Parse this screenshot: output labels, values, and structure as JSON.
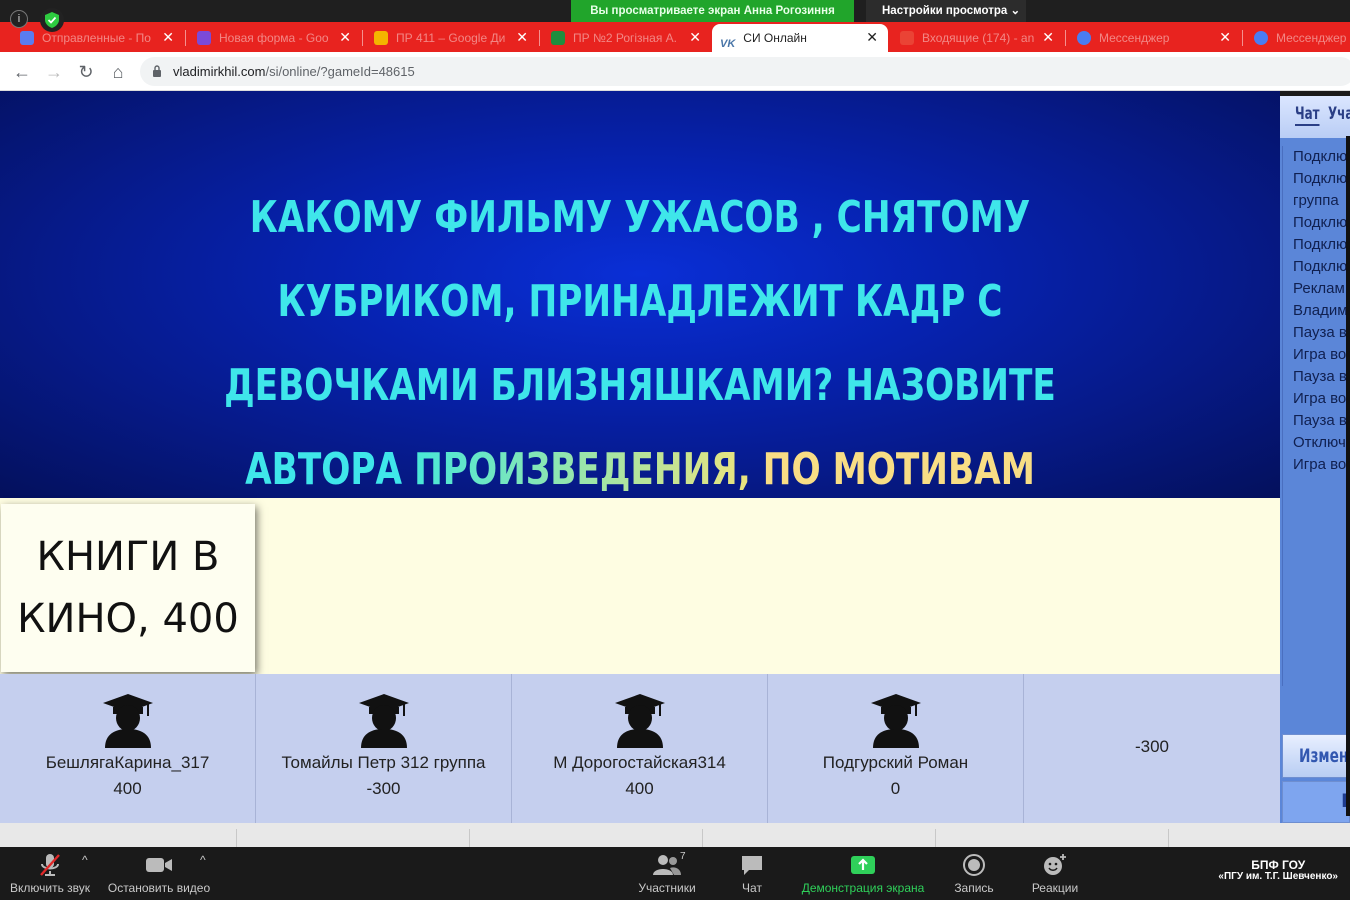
{
  "zoom_share": {
    "banner": "Вы просматриваете экран Анна Рогозиння",
    "view_options": "Настройки просмотра"
  },
  "browser": {
    "tabs": [
      {
        "label": "Отправленные - По",
        "color": "#5a7cf0"
      },
      {
        "label": "Новая форма - Goo",
        "color": "#7b4ad8"
      },
      {
        "label": "ПР 411 – Google Ди",
        "color": "#f4b400"
      },
      {
        "label": "ПР №2 Рогізная А.",
        "color": "#1e8e3e"
      },
      {
        "label": "СИ Онлайн",
        "color": "#4a76a8"
      },
      {
        "label": "Входящие (174) - an",
        "color": "#ea4335"
      },
      {
        "label": "Мессенджер",
        "color": "#4a7cf3"
      },
      {
        "label": "Мессенджер",
        "color": "#4a7cf3"
      }
    ],
    "url_host": "vladimirkhil.com",
    "url_path": "/si/online/?gameId=48615"
  },
  "question": {
    "part1": "КАКОМУ ФИЛЬМУ УЖАСОВ , СНЯТОМУ КУБРИКОМ, ПРИНАДЛЕЖИТ КАДР С ДЕВОЧКАМИ БЛИЗНЯШКАМИ? НАЗОВИТЕ АВТОРА ",
    "part2": "ПРОИЗВЕДЕНИЯ, ",
    "part3": "ПО МОТИВАМ КОТОРОГО СНЯТ ЭТОТ ФИЛЬМ?"
  },
  "theme": {
    "line1": "КНИГИ В",
    "line2": "КИНО, 400"
  },
  "players": [
    {
      "name": "БешлягаКарина_317",
      "score": "400"
    },
    {
      "name": "Томайлы Петр 312 группа",
      "score": "-300"
    },
    {
      "name": "М Дорогостайская314",
      "score": "400"
    },
    {
      "name": "Подгурский Роман",
      "score": "0"
    },
    {
      "name": "",
      "score": "-300"
    }
  ],
  "side_panel": {
    "tab_chat": "Чат",
    "tab_players": "Уча",
    "chat_lines": [
      "Подклю",
      "Подклю",
      "группа",
      "Подклю",
      "Подклю",
      "Подклю",
      "Реклам",
      "Владим",
      "Пауза в",
      "Игра во",
      "Пауза в",
      "Игра во",
      "Пауза в",
      "Отключ",
      "Игра во"
    ],
    "change_button": "Измени",
    "second_button": "П"
  },
  "zoom_toolbar": {
    "unmute": "Включить звук",
    "stop_video": "Остановить видео",
    "participants": "Участники",
    "participants_count": "7",
    "chat": "Чат",
    "share_screen": "Демонстрация экрана",
    "record": "Запись",
    "reactions": "Реакции",
    "brand_line1": "БПФ ГОУ",
    "brand_line2": "«ПГУ им. Т.Г. Шевченко»"
  }
}
